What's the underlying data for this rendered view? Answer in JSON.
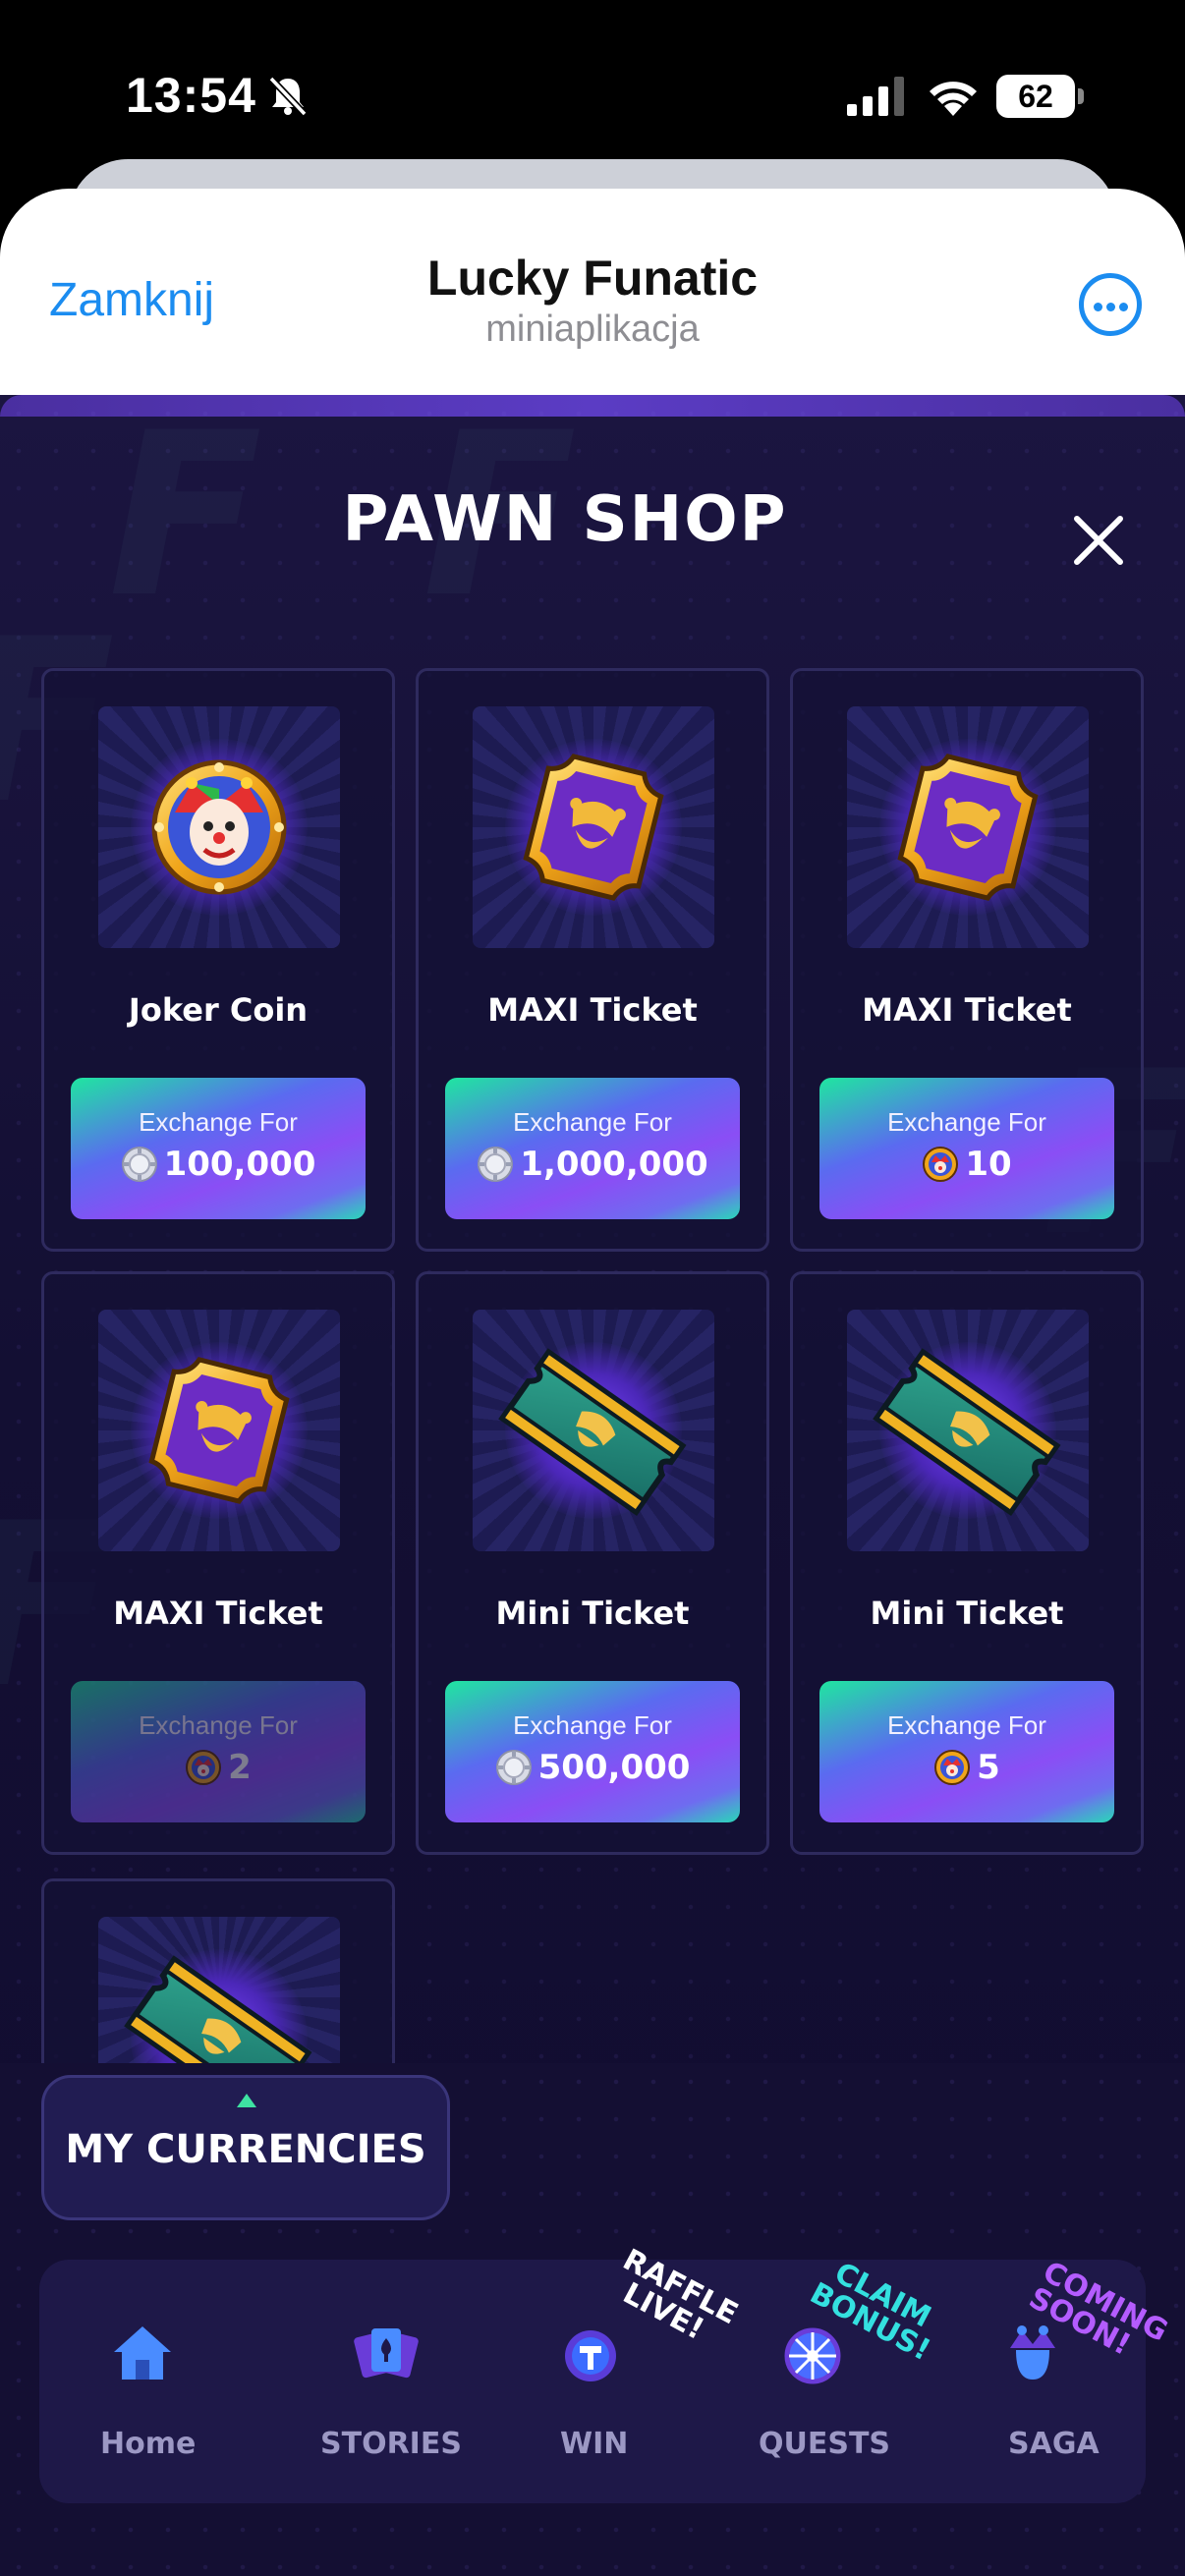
{
  "status_bar": {
    "time": "13:54",
    "battery": "62"
  },
  "telegram": {
    "close_label": "Zamknij",
    "title": "Lucky Funatic",
    "subtitle": "miniaplikacja"
  },
  "shop": {
    "title": "PAWN SHOP",
    "items": [
      {
        "name": "Joker Coin",
        "exchange_label": "Exchange For",
        "price": "100,000",
        "currency": "silver-chip",
        "art": "joker-coin",
        "enabled": true
      },
      {
        "name": "MAXI Ticket",
        "exchange_label": "Exchange For",
        "price": "1,000,000",
        "currency": "silver-chip",
        "art": "maxi-ticket",
        "enabled": true
      },
      {
        "name": "MAXI Ticket",
        "exchange_label": "Exchange For",
        "price": "10",
        "currency": "joker-coin",
        "art": "maxi-ticket",
        "enabled": true
      },
      {
        "name": "MAXI Ticket",
        "exchange_label": "Exchange For",
        "price": "2",
        "currency": "joker-coin",
        "art": "maxi-ticket",
        "enabled": false
      },
      {
        "name": "Mini Ticket",
        "exchange_label": "Exchange For",
        "price": "500,000",
        "currency": "silver-chip",
        "art": "mini-ticket",
        "enabled": true
      },
      {
        "name": "Mini Ticket",
        "exchange_label": "Exchange For",
        "price": "5",
        "currency": "joker-coin",
        "art": "mini-ticket",
        "enabled": true
      }
    ]
  },
  "currencies_button": {
    "label": "MY CURRENCIES"
  },
  "nav": {
    "items": [
      {
        "label": "Home",
        "icon": "home-icon"
      },
      {
        "label": "STORIES",
        "icon": "cards-icon"
      },
      {
        "label": "WIN",
        "icon": "token-icon",
        "tag": "RAFFLE LIVE!"
      },
      {
        "label": "QUESTS",
        "icon": "wheel-icon",
        "tag": "CLAIM BONUS!"
      },
      {
        "label": "SAGA",
        "icon": "jester-icon",
        "tag": "COMING SOON!"
      }
    ]
  },
  "colors": {
    "accent_blue": "#1b8cf0",
    "brand_green": "#1fe6a0",
    "brand_purple": "#8a4ef5",
    "background": "#130f33"
  }
}
